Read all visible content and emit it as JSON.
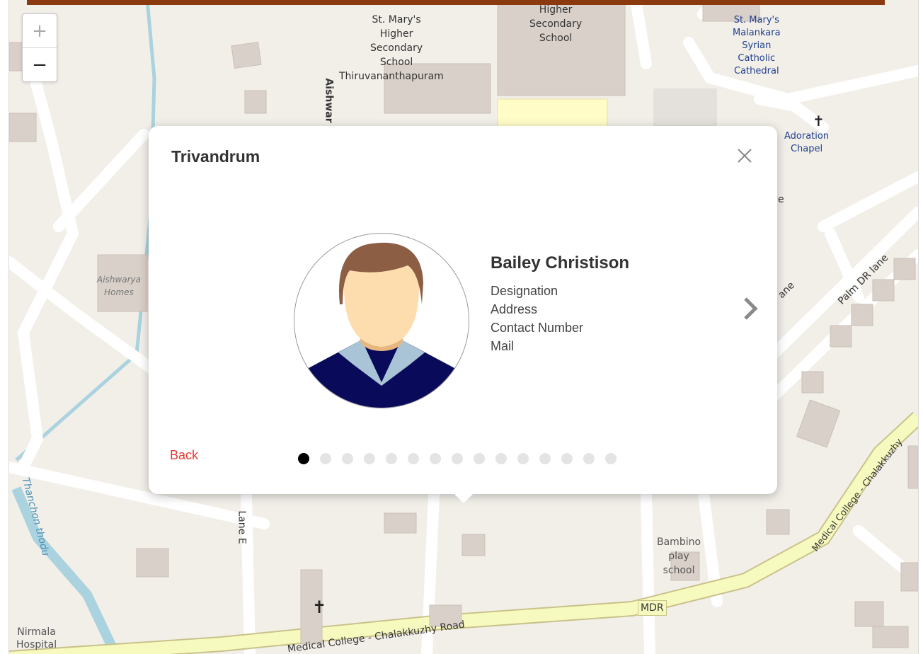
{
  "map": {
    "zoom_in": "+",
    "zoom_out": "−",
    "labels": {
      "st_marys_school": [
        "St. Mary's",
        "Higher",
        "Secondary",
        "School",
        "Thiruvananthapuram"
      ],
      "higher_secondary": [
        "Higher",
        "Secondary",
        "School"
      ],
      "cathedral": [
        "St. Mary's",
        "Malankara",
        "Syrian",
        "Catholic",
        "Cathedral"
      ],
      "adoration_chapel": [
        "Adoration",
        "Chapel"
      ],
      "aishwarya_homes": [
        "Aishwarya",
        "Homes"
      ],
      "aishwarya_road": "Aishwar",
      "palm_dr_lane": "Palm DR lane",
      "lane_fragment": "ane",
      "lane_e": "Lane E",
      "thodu": "Thanchon thodu",
      "bambino": [
        "Bambino",
        "play",
        "school"
      ],
      "mdr": "MDR",
      "medical_college_road": "Medical College - Chalakkuzhy Road",
      "medical_college_road_2": "Medical College - Chalakkuzhy",
      "nirmala": [
        "Nirmala",
        "Hospital"
      ],
      "e_fragment": "e"
    }
  },
  "popup": {
    "title": "Trivandrum",
    "name": "Bailey Christison",
    "fields": [
      "Designation",
      "Address",
      "Contact Number",
      "Mail"
    ],
    "back_label": "Back",
    "pagination": {
      "total": 15,
      "active": 0
    }
  },
  "colors": {
    "top_bar": "#8b3a0f",
    "back_link": "#e53935",
    "road_major": "#f7fabf",
    "building": "#d9d0c9"
  }
}
